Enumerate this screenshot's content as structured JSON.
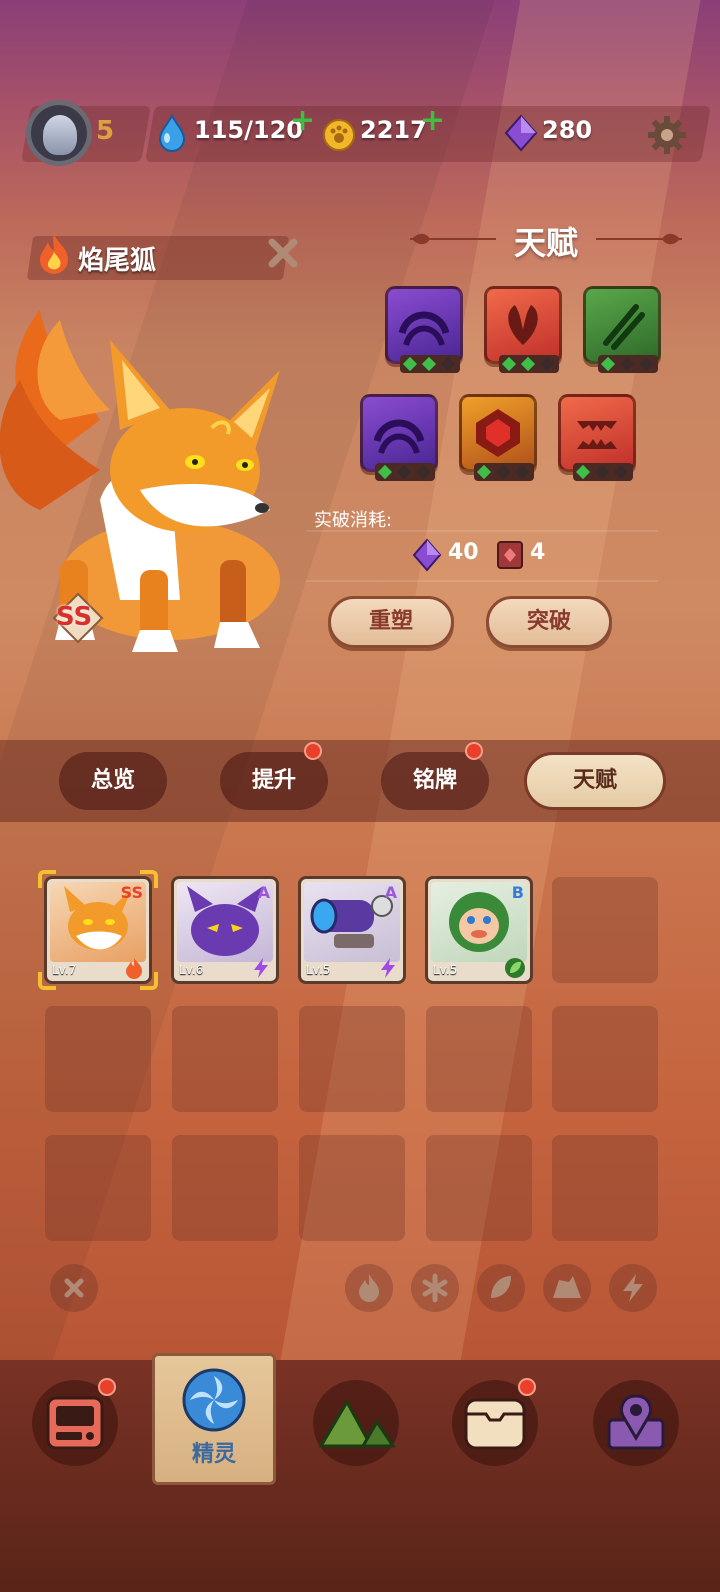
{
  "header": {
    "player_level": "5",
    "energy": "115/120",
    "gold": "2217",
    "gems": "280"
  },
  "pet": {
    "name": "焰尾狐",
    "rank": "SS"
  },
  "talent": {
    "title": "天赋",
    "breakthrough_label": "实破消耗:",
    "cost_gems": "40",
    "cost_item": "4",
    "reshape_button": "重塑",
    "breakthrough_button": "突破"
  },
  "tabs": [
    {
      "label": "总览",
      "badge": false
    },
    {
      "label": "提升",
      "badge": true
    },
    {
      "label": "铭牌",
      "badge": true
    },
    {
      "label": "天赋",
      "badge": false,
      "active": true
    }
  ],
  "pets": [
    {
      "level": "Lv.7",
      "rank": "SS",
      "element": "fire-icon",
      "selected": true
    },
    {
      "level": "Lv.6",
      "rank": "A",
      "element": "lightning-icon"
    },
    {
      "level": "Lv.5",
      "rank": "A",
      "element": "lightning-icon"
    },
    {
      "level": "Lv.5",
      "rank": "B",
      "element": "leaf-icon"
    }
  ],
  "nav": {
    "active_label": "精灵"
  },
  "colors": {
    "accent_red": "#e8402a",
    "plus_green": "#3fbf3f",
    "gem_purple": "#8a4cd0"
  }
}
